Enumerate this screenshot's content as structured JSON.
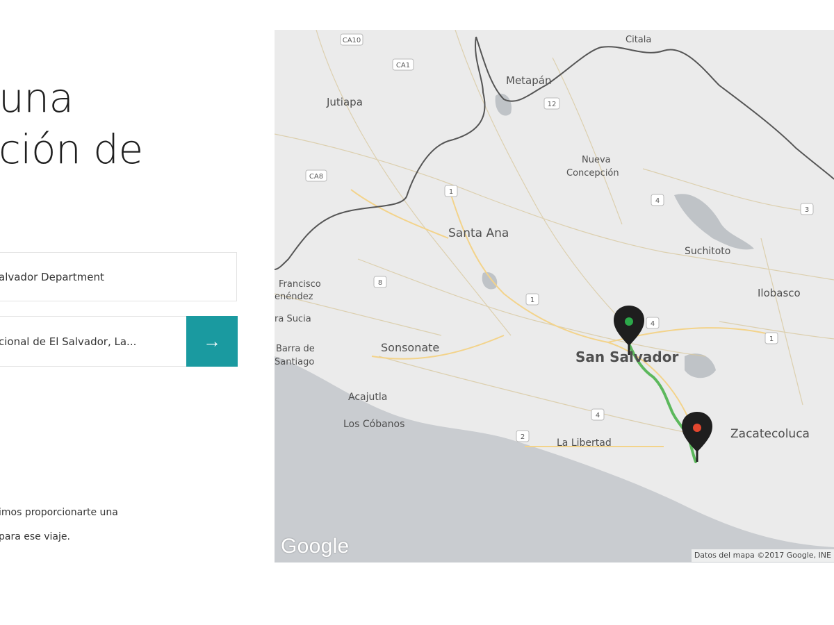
{
  "headline": {
    "line1": "una",
    "line2": "ción de"
  },
  "form": {
    "pickup_value": "alvador Department",
    "destination_value": "cional de El Salvador, La...",
    "go_icon": "arrow-right-icon",
    "go_glyph": "→"
  },
  "note": {
    "line1": "imos proporcionarte una",
    "line2": "para ese viaje."
  },
  "map": {
    "labels": {
      "metapan": "Metapán",
      "jutiapa": "Jutiapa",
      "nueva1": "Nueva",
      "nueva2": "Concepción",
      "santa_ana": "Santa Ana",
      "suchitoto": "Suchitoto",
      "francisco1": "Francisco",
      "francisco2": "enéndez",
      "sucia": "ra Sucia",
      "ilobasco": "Ilobasco",
      "sonsonate": "Sonsonate",
      "san_salvador": "San Salvador",
      "barra1": "Barra de",
      "barra2": "Santiago",
      "acajutla": "Acajutla",
      "cobanos": "Los Cóbanos",
      "libertad": "La Libertad",
      "zacatecoluca": "Zacatecoluca",
      "citala": "Citala"
    },
    "shields": {
      "ca10": "CA10",
      "ca1": "CA1",
      "ca8": "CA8",
      "r12": "12",
      "r1a": "1",
      "r1b": "1",
      "r1c": "1",
      "r4a": "4",
      "r4b": "4",
      "r4c": "4",
      "r8": "8",
      "r3": "3",
      "r2": "2"
    },
    "google_logo": "Google",
    "attribution": "Datos del mapa ©2017 Google, INE",
    "colors": {
      "route": "#5cb85c",
      "origin_marker": "#2ca84a",
      "destination_marker": "#e2472f",
      "ocean": "#c9ccd0",
      "land": "#eaeaea"
    }
  }
}
